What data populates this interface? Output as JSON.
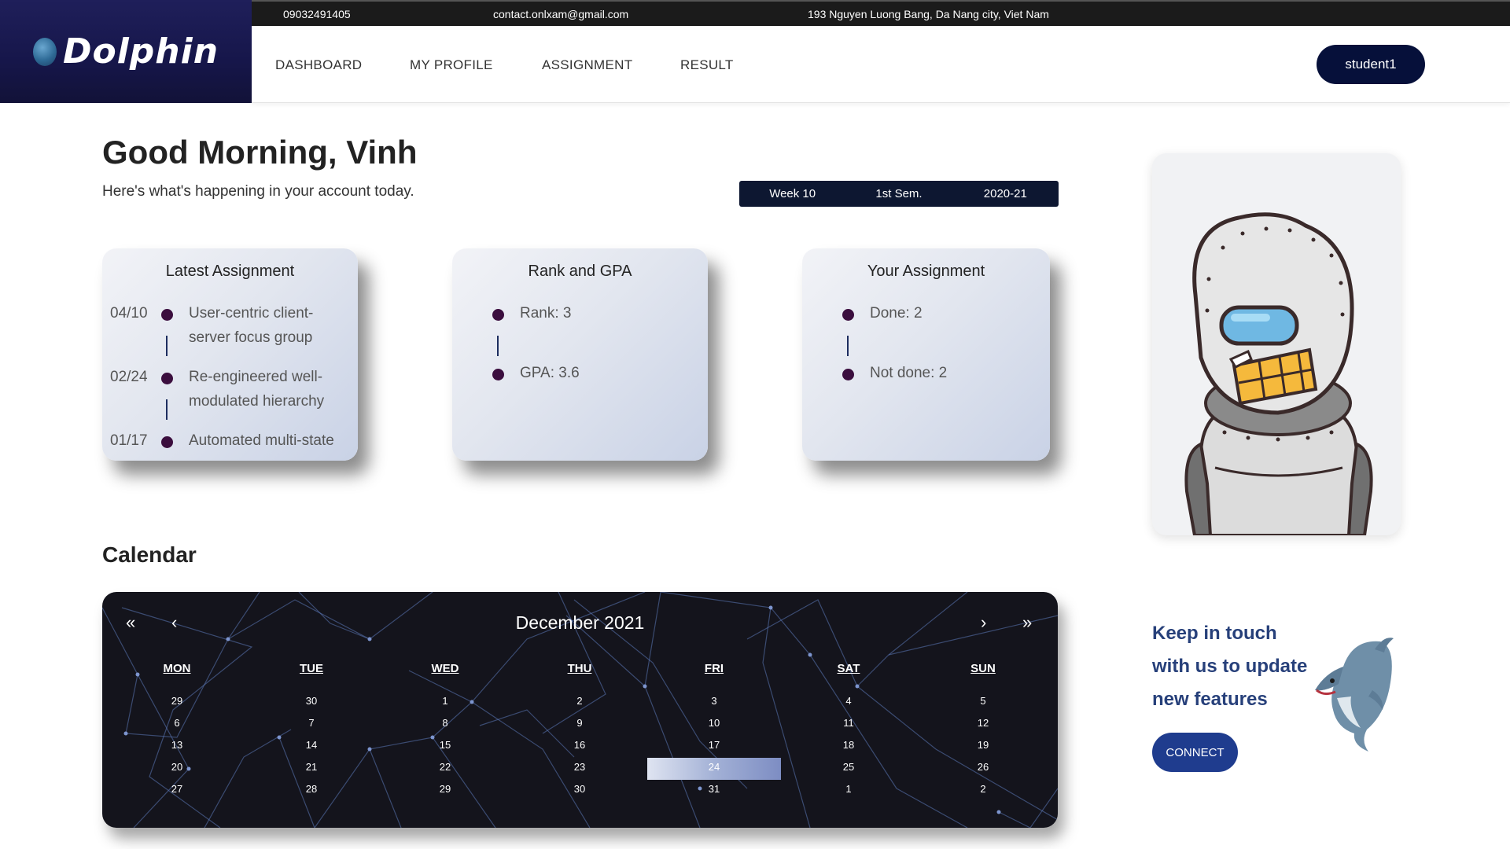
{
  "topbar": {
    "phone": "09032491405",
    "email": "contact.onlxam@gmail.com",
    "address": "193 Nguyen Luong Bang, Da Nang city, Viet Nam"
  },
  "brand": {
    "name": "Dolphin",
    "icon": "globe-icon"
  },
  "nav": {
    "items": [
      "DASHBOARD",
      "MY PROFILE",
      "ASSIGNMENT",
      "RESULT"
    ],
    "user": "student1"
  },
  "greeting": {
    "title": "Good Morning, Vinh",
    "subtitle": "Here's what's happening in your account today."
  },
  "term": {
    "week": "Week 10",
    "semester": "1st Sem.",
    "year": "2020-21"
  },
  "cards": {
    "latest_assignment": {
      "title": "Latest Assignment",
      "items": [
        {
          "date": "04/10",
          "line1": "User-centric client-",
          "line2": "server focus group"
        },
        {
          "date": "02/24",
          "line1": "Re-engineered well-",
          "line2": "modulated hierarchy"
        },
        {
          "date": "01/17",
          "line1": "Automated multi-state",
          "line2": ""
        }
      ]
    },
    "rank_gpa": {
      "title": "Rank and GPA",
      "rank": "Rank: 3",
      "gpa": "GPA: 3.6"
    },
    "your_assignment": {
      "title": "Your Assignment",
      "done": "Done: 2",
      "not_done": "Not done: 2"
    }
  },
  "calendar": {
    "heading": "Calendar",
    "month": "December 2021",
    "nav": {
      "first": "«",
      "prev": "‹",
      "next": "›",
      "last": "»"
    },
    "days_of_week": [
      "MON",
      "TUE",
      "WED",
      "THU",
      "FRI",
      "SAT",
      "SUN"
    ],
    "weeks": [
      [
        "29",
        "30",
        "1",
        "2",
        "3",
        "4",
        "5"
      ],
      [
        "6",
        "7",
        "8",
        "9",
        "10",
        "11",
        "12"
      ],
      [
        "13",
        "14",
        "15",
        "16",
        "17",
        "18",
        "19"
      ],
      [
        "20",
        "21",
        "22",
        "23",
        "24",
        "25",
        "26"
      ],
      [
        "27",
        "28",
        "29",
        "30",
        "31",
        "1",
        "2"
      ]
    ],
    "selected": "24"
  },
  "contact": {
    "line1": "Keep in touch",
    "line2": "with us to update",
    "line3": "new features",
    "button": "CONNECT"
  },
  "colors": {
    "navy": "#06103a",
    "accent": "#1f3c8e",
    "dot": "#3b0e3e",
    "text_blue": "#27407a"
  }
}
